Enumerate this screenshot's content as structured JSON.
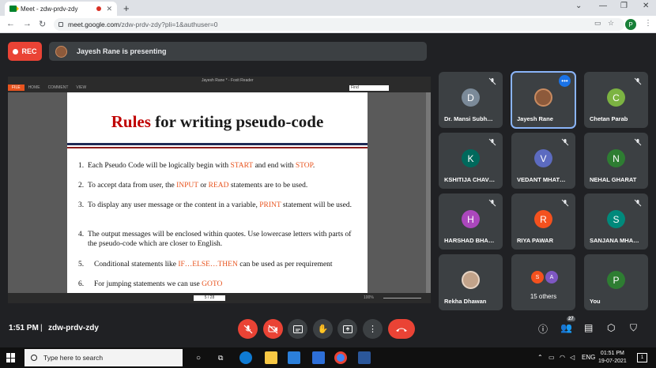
{
  "browser": {
    "tab_title": "Meet - zdw-prdv-zdy",
    "url_host": "meet.google.com",
    "url_path": "/zdw-prdv-zdy?pli=1&authuser=0",
    "profile_initial": "P"
  },
  "meet": {
    "rec_label": "REC",
    "presenter_text": "Jayesh Rane is presenting",
    "time": "1:51 PM",
    "separator": "|",
    "meeting_code": "zdw-prdv-zdy",
    "participants_count": "27"
  },
  "pdf": {
    "window_title": "Jayesh Rane * - Foxit Reader",
    "ribbon": [
      "FILE",
      "HOME",
      "COMMENT",
      "VIEW"
    ],
    "find_placeholder": "Find",
    "page_indicator": "5 / 28",
    "zoom": "100%"
  },
  "slide": {
    "title_red": "Rules",
    "title_rest": " for writing pseudo-code",
    "points": [
      {
        "num": "1.",
        "parts": [
          "Each Pseudo Code will be logically begin with ",
          "START",
          " and end with ",
          "STOP",
          "."
        ]
      },
      {
        "num": "2.",
        "parts": [
          "To accept data from user, the ",
          "INPUT",
          " or ",
          "READ",
          " statements are to be used."
        ]
      },
      {
        "num": "3.",
        "parts": [
          "To display any user message or the content in a variable, ",
          "PRINT",
          " statement will be used.",
          "",
          ""
        ]
      },
      {
        "num": "4.",
        "parts": [
          "The output messages will be enclosed within quotes. Use lowercase letters with parts of the pseudo-code which are closer to English.",
          "",
          "",
          "",
          ""
        ]
      },
      {
        "num": "5.",
        "parts": [
          "Conditional statements like ",
          "IF…ELSE…THEN",
          " can be used as per requirement",
          "",
          ""
        ]
      },
      {
        "num": "6.",
        "parts": [
          "For jumping statements we can use ",
          "GOTO",
          "",
          "",
          ""
        ]
      }
    ]
  },
  "participants": [
    {
      "name": "Dr. Mansi Subh…",
      "initial": "D",
      "color": "#7b8a99"
    },
    {
      "name": "Jayesh Rane",
      "initial": "",
      "color": "#8d5a3b"
    },
    {
      "name": "Chetan Parab",
      "initial": "C",
      "color": "#7cb342"
    },
    {
      "name": "KSHITIJA CHAV…",
      "initial": "K",
      "color": "#00695c"
    },
    {
      "name": "VEDANT MHAT…",
      "initial": "V",
      "color": "#5c6bc0"
    },
    {
      "name": "NEHAL GHARAT",
      "initial": "N",
      "color": "#2e7d32"
    },
    {
      "name": "HARSHAD BHA…",
      "initial": "H",
      "color": "#ab47bc"
    },
    {
      "name": "RIYA PAWAR",
      "initial": "R",
      "color": "#f4511e"
    },
    {
      "name": "SANJANA MHA…",
      "initial": "S",
      "color": "#00897b"
    },
    {
      "name": "Rekha Dhawan",
      "initial": "",
      "color": "#c2a38a"
    },
    {
      "name": "15 others",
      "initial_a": "S",
      "initial_b": "A"
    },
    {
      "name": "You",
      "initial": "P",
      "color": "#2e7d32"
    }
  ],
  "taskbar": {
    "search_placeholder": "Type here to search",
    "lang": "ENG",
    "clock_time": "01:51 PM",
    "clock_date": "19-07-2021",
    "notif_count": "1"
  }
}
